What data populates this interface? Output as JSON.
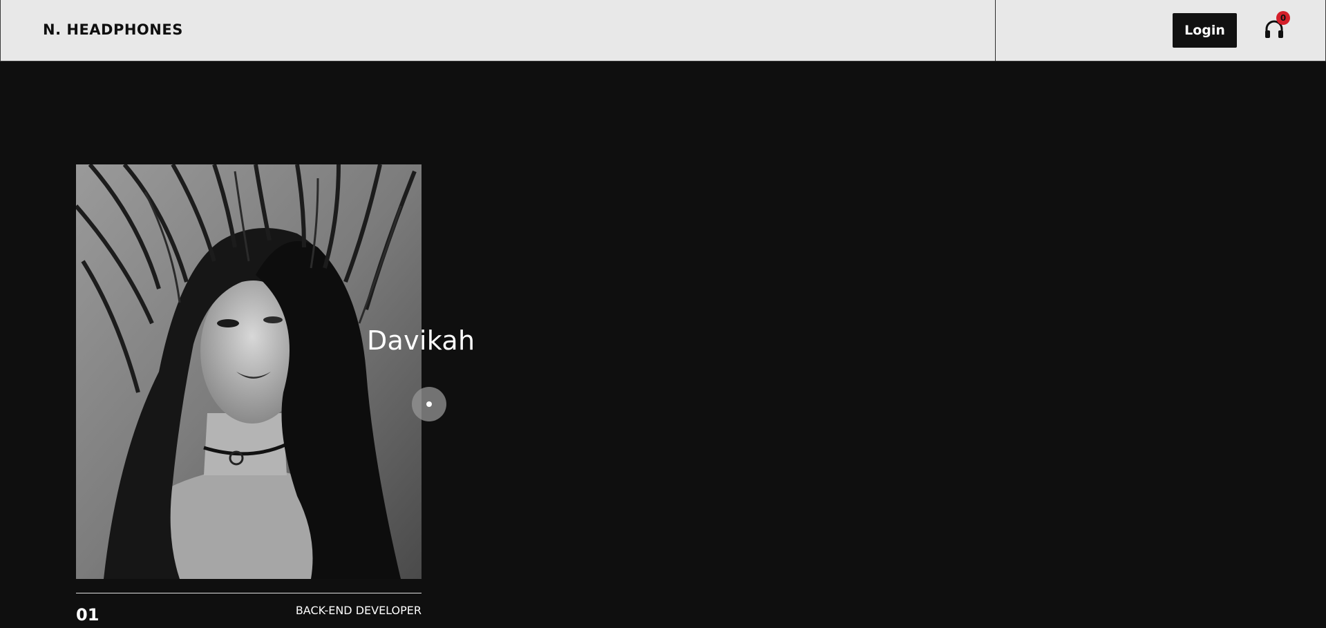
{
  "header": {
    "logo": "N. HEADPHONES",
    "login_label": "Login",
    "cart_icon": "headphones-icon",
    "cart_count": "0"
  },
  "card": {
    "name": "Davikah",
    "number": "01",
    "role": "BACK-END DEVELOPER",
    "image_icon": "portrait-photo"
  },
  "colors": {
    "header_bg": "#e8e8e8",
    "page_bg": "#0f0f0f",
    "button_bg": "#111111",
    "badge": "#d41f2a",
    "text_light": "#ffffff"
  }
}
